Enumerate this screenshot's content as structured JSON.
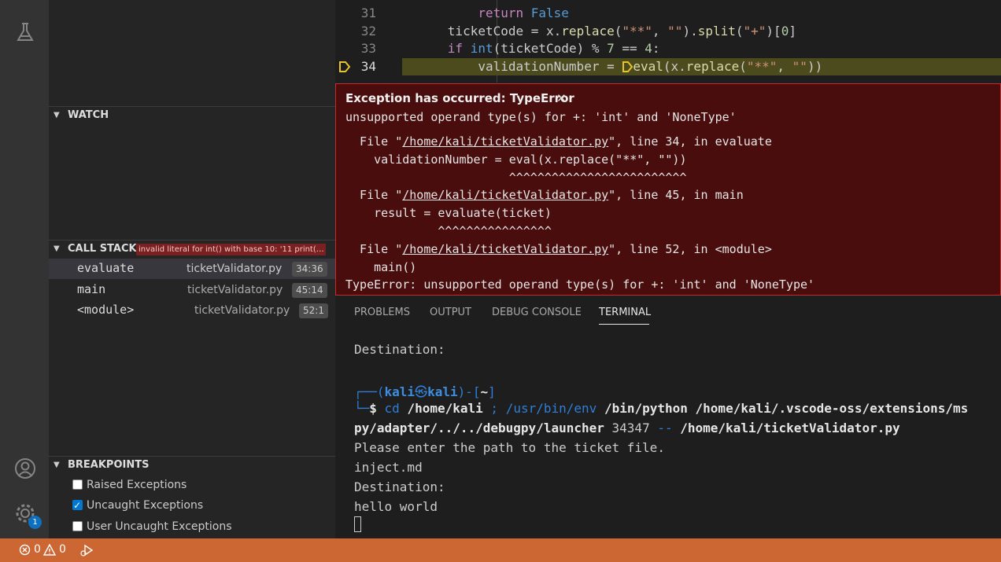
{
  "sidebar": {
    "watch": {
      "title": "WATCH"
    },
    "call_stack": {
      "title": "CALL STACK",
      "exception_badge": "invalid literal for int() with base 10: '11 print(\"...",
      "frames": [
        {
          "name": "evaluate",
          "file": "ticketValidator.py",
          "pos": "34:36"
        },
        {
          "name": "main",
          "file": "ticketValidator.py",
          "pos": "45:14"
        },
        {
          "name": "<module>",
          "file": "ticketValidator.py",
          "pos": "52:1"
        }
      ]
    },
    "breakpoints": {
      "title": "BREAKPOINTS",
      "items": [
        {
          "label": "Raised Exceptions",
          "checked": false
        },
        {
          "label": "Uncaught Exceptions",
          "checked": true
        },
        {
          "label": "User Uncaught Exceptions",
          "checked": false
        }
      ]
    }
  },
  "activity": {
    "settings_badge": "1"
  },
  "editor": {
    "line_numbers": [
      "31",
      "32",
      "33",
      "34"
    ]
  },
  "exception": {
    "title": "Exception has occurred: TypeError",
    "message": "unsupported operand type(s) for +: 'int' and 'NoneType'",
    "tb1_file": "/home/kali/ticketValidator.py",
    "tb1_rest": "\", line 34, in evaluate",
    "tb1_code": "    validationNumber = eval(x.replace(\"**\", \"\"))",
    "tb1_caret": "                       ^^^^^^^^^^^^^^^^^^^^^^^^^",
    "tb2_file": "/home/kali/ticketValidator.py",
    "tb2_rest": "\", line 45, in main",
    "tb2_code": "    result = evaluate(ticket)",
    "tb2_caret": "             ^^^^^^^^^^^^^^^^",
    "tb3_file": "/home/kali/ticketValidator.py",
    "tb3_rest": "\", line 52, in <module>",
    "tb3_code": "    main()",
    "final": "TypeError: unsupported operand type(s) for +: 'int' and 'NoneType'"
  },
  "panel": {
    "tabs": [
      "PROBLEMS",
      "OUTPUT",
      "DEBUG CONSOLE",
      "TERMINAL"
    ],
    "active_tab": "TERMINAL",
    "terminal": {
      "line1": "Destination:",
      "prompt_user": "kali",
      "prompt_at": "㉿",
      "prompt_host": "kali",
      "prompt_dir": "~",
      "cmd_cd": "cd",
      "cmd_home": "/home/kali",
      "cmd_sep": ";",
      "cmd_env": "/usr/bin/env",
      "cmd_python": "/bin/python /home/kali/.vscode-oss/extensions/ms",
      "cmd_cont_a": "py/adapter/../../debugpy/launcher",
      "cmd_port": "34347",
      "cmd_dash": "--",
      "cmd_script": "/home/kali/ticketValidator.py",
      "out1": "Please enter the path to the ticket file.",
      "out2": "inject.md",
      "out3": "Destination:",
      "out4": "hello world"
    }
  },
  "status": {
    "errors": "0",
    "warnings": "0"
  }
}
